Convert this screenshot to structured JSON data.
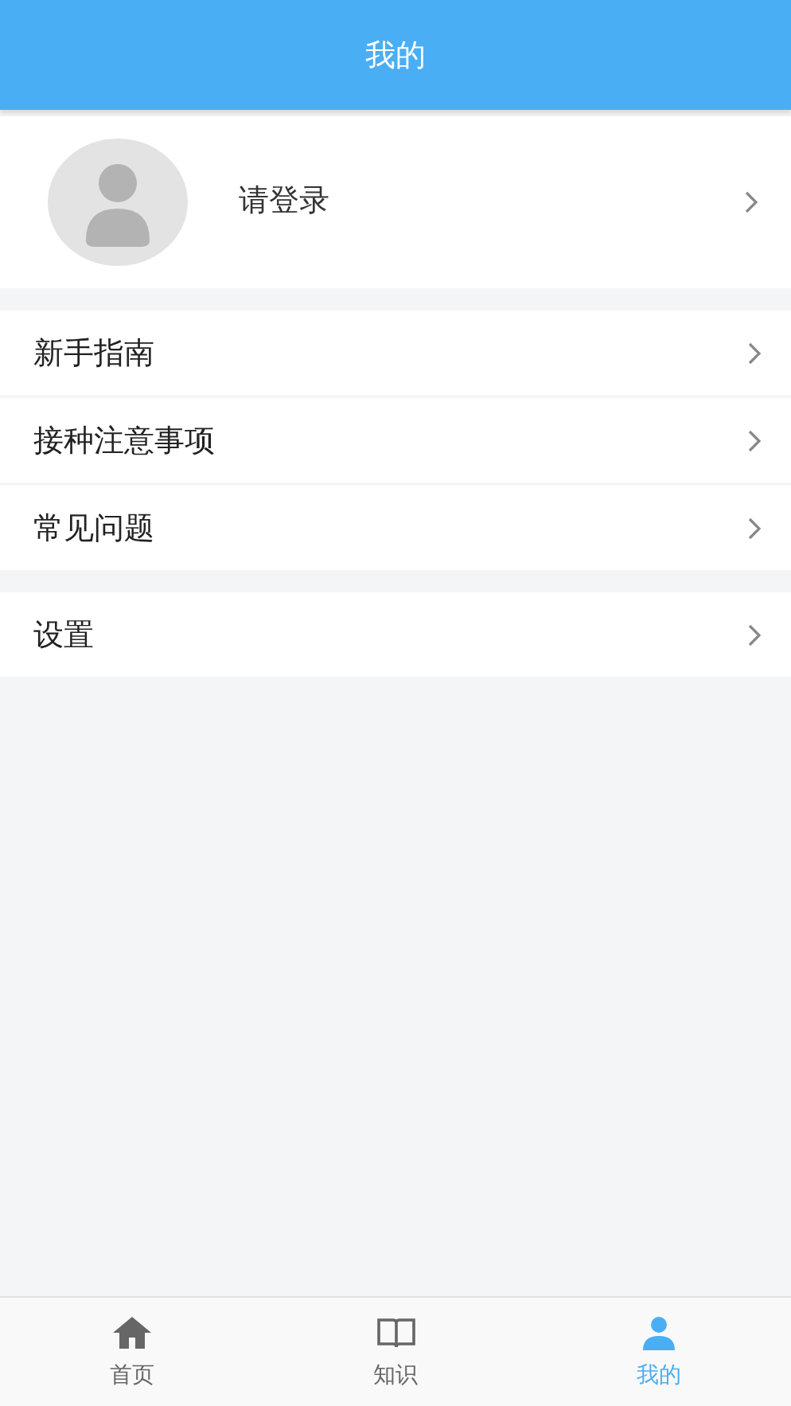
{
  "header": {
    "title": "我的"
  },
  "profile": {
    "label": "请登录"
  },
  "menu_groups": [
    {
      "items": [
        {
          "label": "新手指南"
        },
        {
          "label": "接种注意事项"
        },
        {
          "label": "常见问题"
        }
      ]
    },
    {
      "items": [
        {
          "label": "设置"
        }
      ]
    }
  ],
  "tab_bar": [
    {
      "kind": "home",
      "label": "首页",
      "selected": false
    },
    {
      "kind": "book",
      "label": "知识",
      "selected": false
    },
    {
      "kind": "user",
      "label": "我的",
      "selected": true
    }
  ]
}
